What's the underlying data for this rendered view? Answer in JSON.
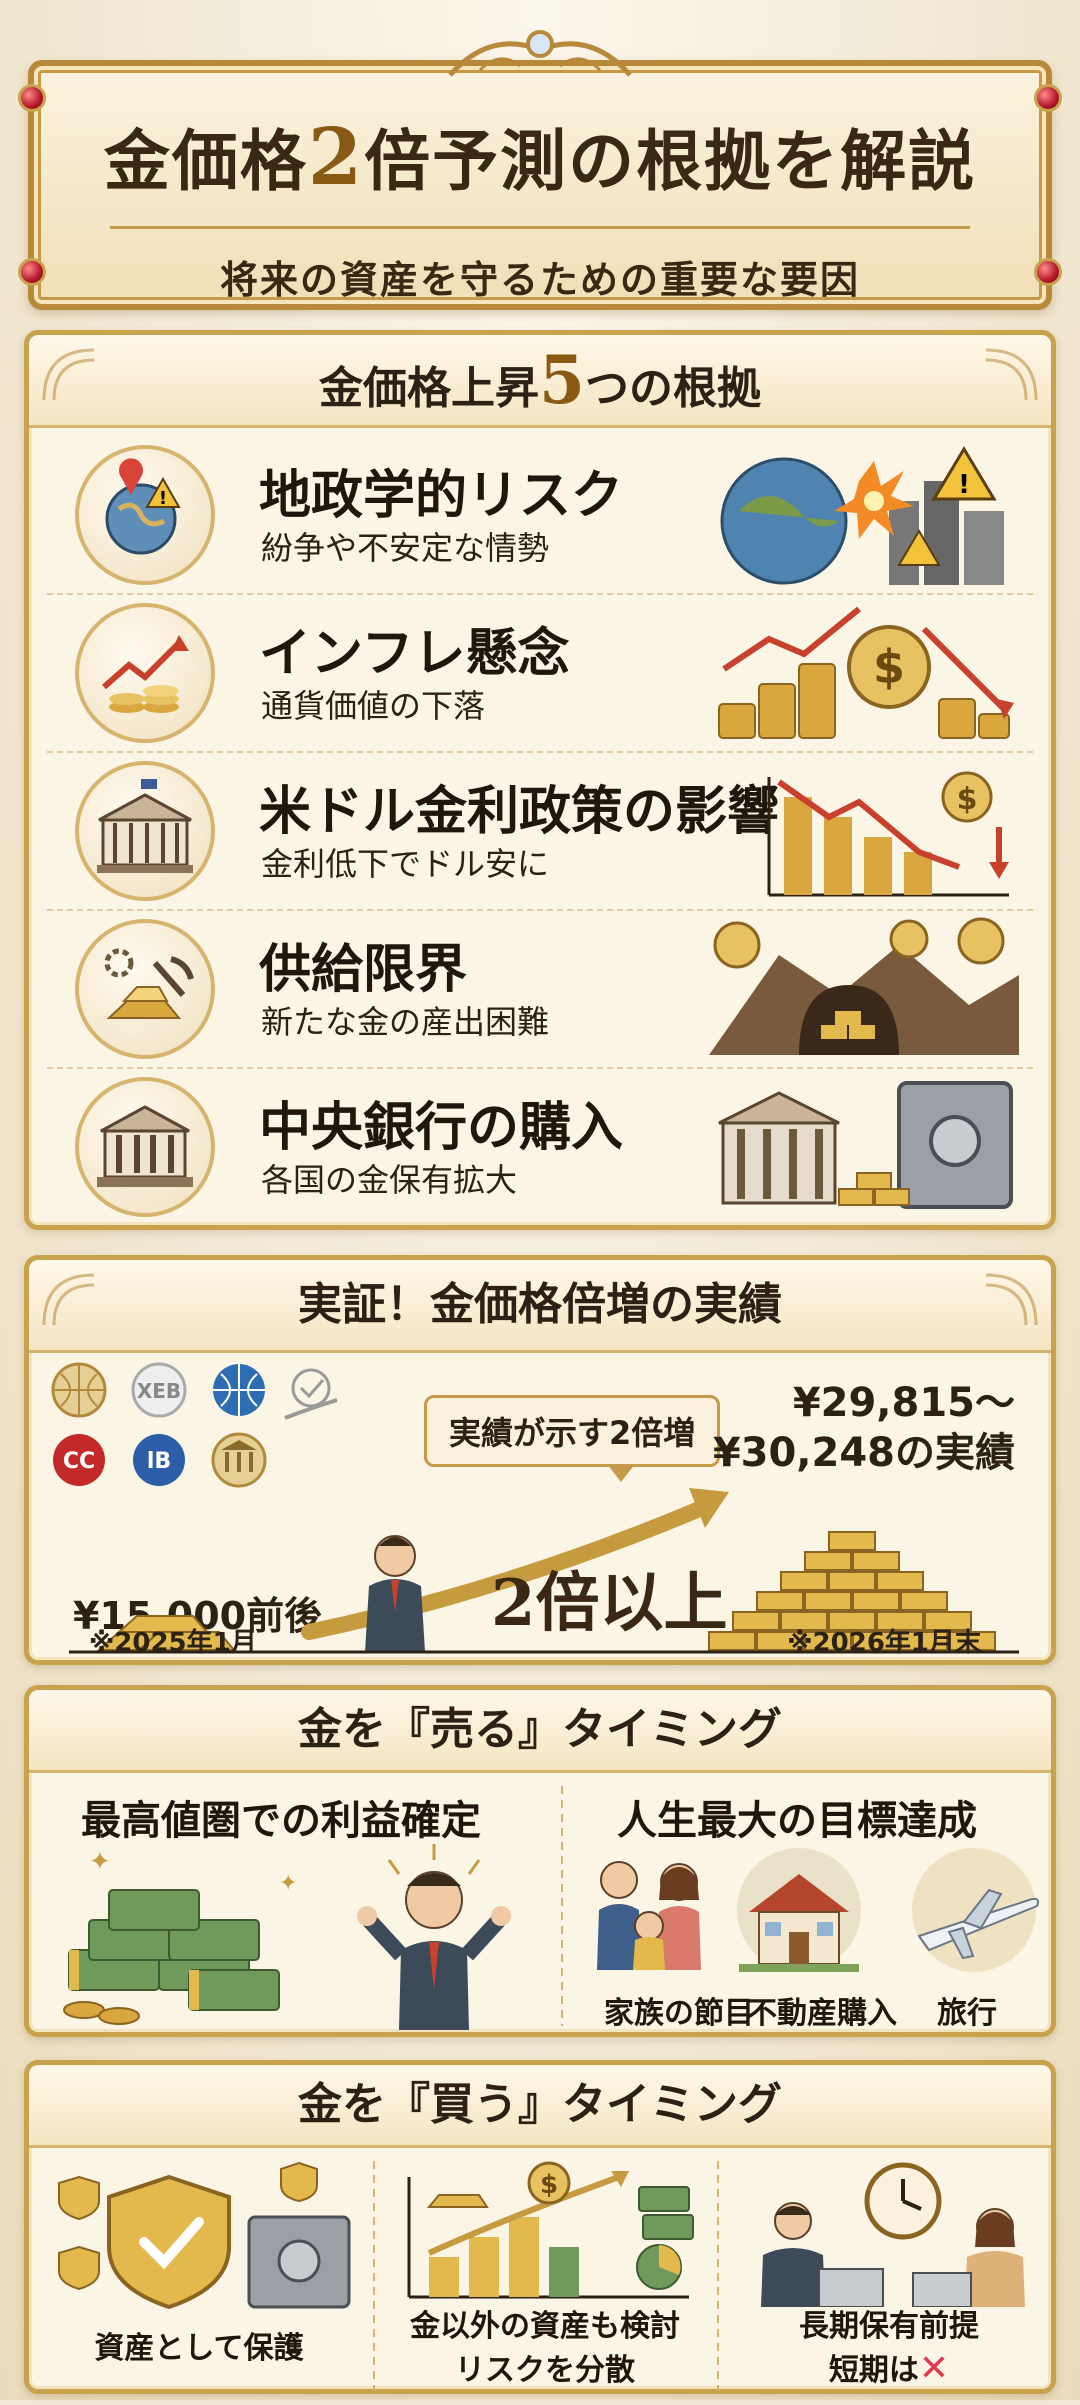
{
  "header": {
    "title_pre": "金価格",
    "title_num": "2",
    "title_post": "倍予測の根拠を解説",
    "subtitle": "将来の資産を守るための重要な要因"
  },
  "reasons_panel": {
    "title_pre": "金価格上昇",
    "title_num": "5",
    "title_post": "つの根拠",
    "items": [
      {
        "title": "地政学的リスク",
        "desc": "紛争や不安定な情勢",
        "icon": "globe-warning-icon"
      },
      {
        "title": "インフレ懸念",
        "desc": "通貨価値の下落",
        "icon": "rising-coins-icon"
      },
      {
        "title": "米ドル金利政策の影響",
        "desc": "金利低下でドル安に",
        "icon": "us-capitol-icon"
      },
      {
        "title": "供給限界",
        "desc": "新たな金の産出困難",
        "icon": "mining-icon"
      },
      {
        "title": "中央銀行の購入",
        "desc": "各国の金保有拡大",
        "icon": "central-bank-icon"
      }
    ]
  },
  "proof_panel": {
    "title": "実証！金価格倍増の実績",
    "bubble": "実績が示す2倍増",
    "start_price": "¥15,000前後",
    "end_price_line1": "¥29,815～",
    "end_price_line2": "¥30,248の実績",
    "multiplier": "2倍以上",
    "start_date": "※2025年1月",
    "end_date": "※2026年1月末",
    "badge_labels": [
      "XEB",
      "CC",
      "lB"
    ]
  },
  "sell_panel": {
    "title": "金を『売る』タイミング",
    "left_title": "最高値圏での利益確定",
    "right_title": "人生最大の目標達成",
    "captions": [
      "家族の節目",
      "不動産購入",
      "旅行"
    ]
  },
  "buy_panel": {
    "title": "金を『買う』タイミング",
    "captions": [
      {
        "line1": "資産として保護",
        "line2": ""
      },
      {
        "line1": "金以外の資産も検討",
        "line2": "リスクを分散"
      },
      {
        "line1": "長期保有前提",
        "line2": "短期は"
      }
    ],
    "cross_mark": "✕"
  },
  "colors": {
    "gold": "#c9a24d",
    "accent_red": "#e0394d",
    "text": "#2b2115"
  }
}
